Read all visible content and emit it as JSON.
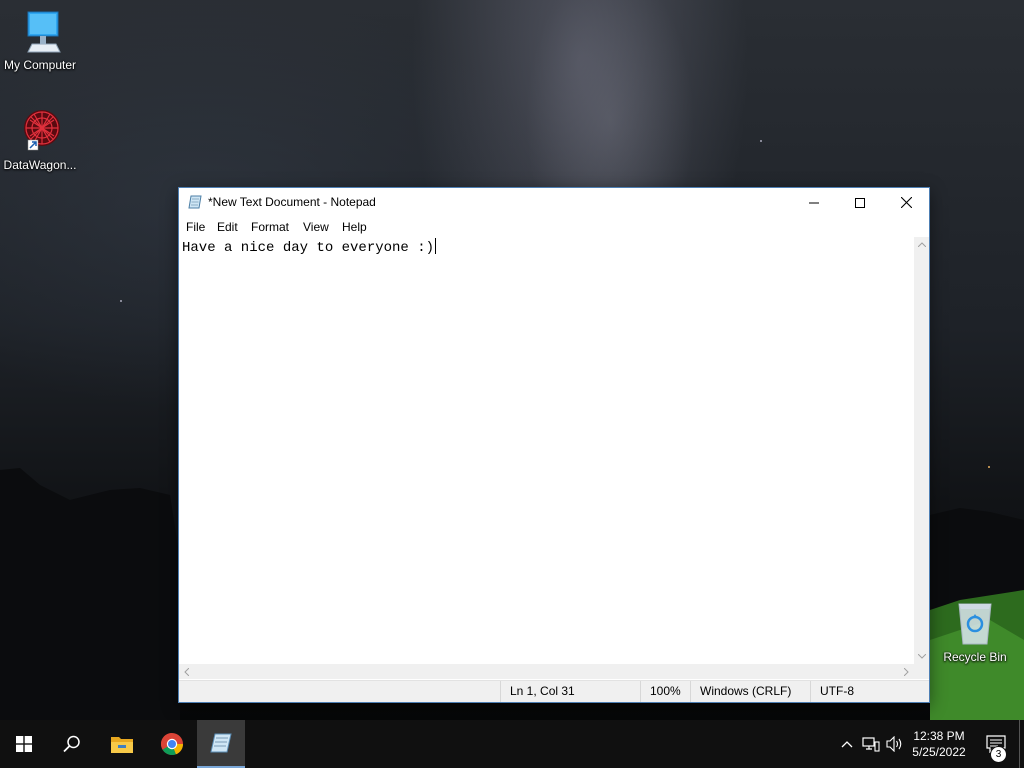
{
  "desktop": {
    "icons": [
      {
        "label": "My Computer",
        "icon": "computer-icon"
      },
      {
        "label": "DataWagon...",
        "icon": "datawagon-app-icon"
      },
      {
        "label": "Recycle Bin",
        "icon": "recycle-bin-icon"
      }
    ]
  },
  "window": {
    "title": "*New Text Document - Notepad",
    "menu": [
      "File",
      "Edit",
      "Format",
      "View",
      "Help"
    ],
    "content": "Have a nice day to everyone :)",
    "status": {
      "position": "Ln 1, Col 31",
      "zoom": "100%",
      "line_ending": "Windows (CRLF)",
      "encoding": "UTF-8"
    }
  },
  "taskbar": {
    "apps": [
      "start-icon",
      "search-icon",
      "file-explorer-icon",
      "chrome-icon",
      "notepad-icon"
    ],
    "active_app": "notepad-icon",
    "clock": {
      "time": "12:38 PM",
      "date": "5/25/2022"
    },
    "notification_count": "3"
  },
  "colors": {
    "window_border": "#4d7fb4",
    "taskbar": "#101010",
    "active_indicator": "#7aa7d8"
  }
}
